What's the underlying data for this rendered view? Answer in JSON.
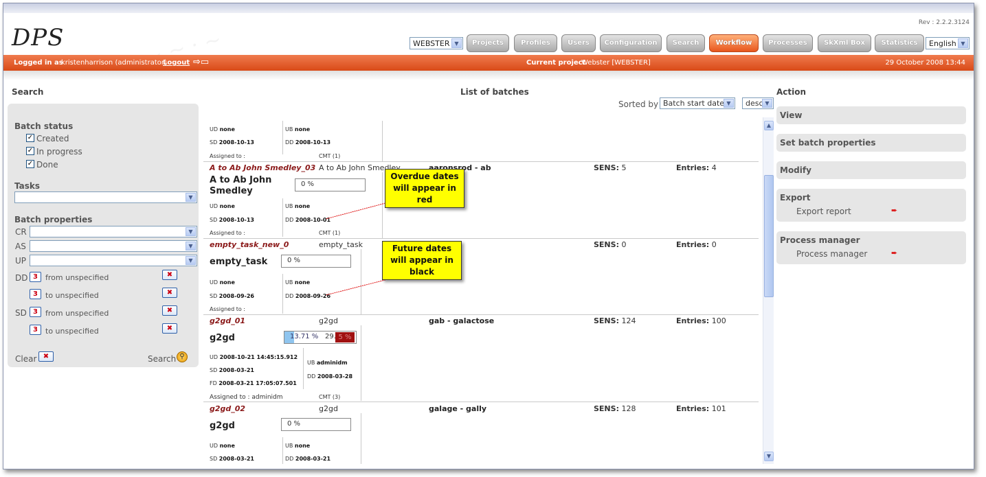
{
  "header": {
    "logo": "DPS",
    "revision": "Rev : 2.2.2.3124",
    "project_select": "WEBSTER",
    "language_select": "English",
    "nav": [
      "Projects",
      "Profiles",
      "Users",
      "Configuration",
      "Search",
      "Workflow",
      "Processes",
      "SkXml Box",
      "Statistics"
    ],
    "active_nav": "Workflow"
  },
  "status_bar": {
    "logged_in_label": "Logged in as",
    "user": "kristenharrison (administrator)",
    "logout": "Logout",
    "current_project_label": "Current project",
    "current_project": "Webster [WEBSTER]",
    "datetime": "29 October 2008 13:44"
  },
  "search_panel": {
    "title": "Search",
    "batch_status_label": "Batch status",
    "statuses": [
      {
        "label": "Created",
        "checked": true
      },
      {
        "label": "In progress",
        "checked": true
      },
      {
        "label": "Done",
        "checked": true
      }
    ],
    "tasks_label": "Tasks",
    "batch_properties_label": "Batch properties",
    "property_fields": [
      "CR",
      "AS",
      "UP"
    ],
    "date_filters": [
      {
        "prefix": "DD",
        "text": "from unspecified"
      },
      {
        "prefix": "",
        "text": "to unspecified"
      },
      {
        "prefix": "SD",
        "text": "from unspecified"
      },
      {
        "prefix": "",
        "text": "to unspecified"
      }
    ],
    "calendar_digit": "3",
    "clear": "Clear",
    "search": "Search"
  },
  "list": {
    "title": "List of batches",
    "sorted_by_label": "Sorted by",
    "sort_field": "Batch start date",
    "sort_order": "desc",
    "top_partial": {
      "ud": "none",
      "ub": "none",
      "sd": "2008-10-13",
      "dd": "2008-10-13",
      "assigned": "Assigned to :",
      "cmt": "CMT (1)"
    },
    "batches": [
      {
        "id": "A to Ab John Smedley_03",
        "desc": "A to Ab John Smedley",
        "collection": "aaronsrod - ab",
        "sens": "5",
        "entries": "4",
        "title_line1": "A to Ab John",
        "title_line2": "Smedley",
        "progress": "0 %",
        "ud": "none",
        "ub": "none",
        "sd": "2008-10-13",
        "dd": "2008-10-01",
        "assigned": "Assigned to :",
        "cmt": "CMT (1)"
      },
      {
        "id": "empty_task_new_0",
        "desc": "empty_task",
        "collection": "",
        "sens": "0",
        "entries": "0",
        "title_line1": "empty_task",
        "progress": "0 %",
        "ud": "none",
        "ub": "none",
        "sd": "2008-09-26",
        "dd": "2008-09-26",
        "assigned": "Assigned to :"
      },
      {
        "id": "g2gd_01",
        "desc": "g2gd",
        "collection": "gab - galactose",
        "sens": "124",
        "entries": "100",
        "title_line1": "g2gd",
        "progress_a": "13.71 %",
        "progress_b": "29.",
        "progress_b_tail": "5 %",
        "ud": "2008-10-21 14:45:15.912",
        "sd": "2008-03-21",
        "fd": "2008-03-21 17:05:07.501",
        "ub": "adminidm",
        "dd": "2008-03-28",
        "assigned": "Assigned to : adminidm",
        "cmt": "CMT (3)"
      },
      {
        "id": "g2gd_02",
        "desc": "g2gd",
        "collection": "galage - gally",
        "sens": "128",
        "entries": "101",
        "title_line1": "g2gd",
        "progress": "0 %",
        "ud": "none",
        "ub": "none",
        "sd": "2008-03-21",
        "dd": "2008-03-21"
      }
    ],
    "labels": {
      "ud": "UD",
      "ub": "UB",
      "sd": "SD",
      "dd": "DD",
      "fd": "FD",
      "sens": "SENS:",
      "entries": "Entries:"
    }
  },
  "callouts": {
    "overdue": "Overdue dates will appear in red",
    "future": "Future dates will appear in black"
  },
  "action_panel": {
    "title": "Action",
    "view": "View",
    "set_props": "Set batch properties",
    "modify": "Modify",
    "export": "Export",
    "export_report": "Export report",
    "process_manager_title": "Process manager",
    "process_manager": "Process manager"
  }
}
